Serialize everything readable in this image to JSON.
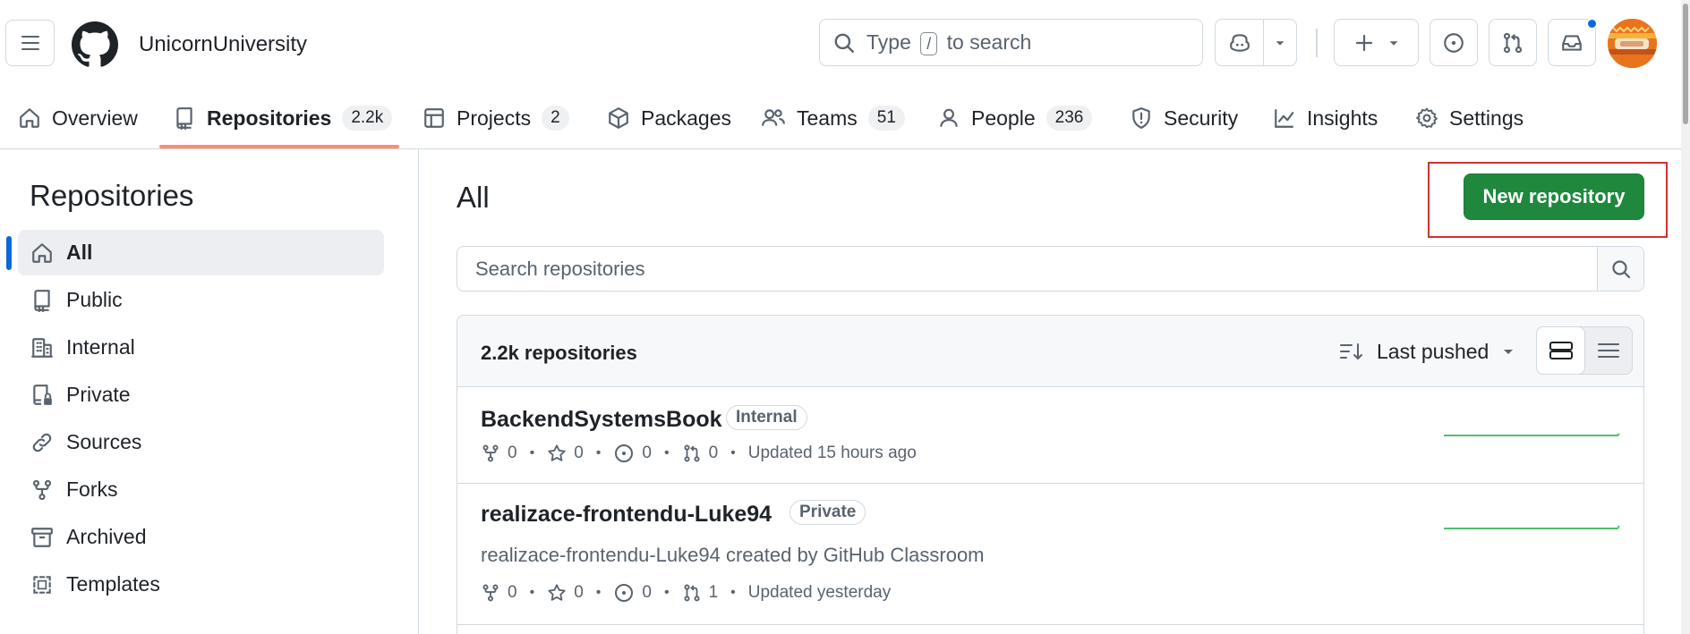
{
  "header": {
    "org_name": "UnicornUniversity",
    "search_prefix": "Type",
    "search_key": "/",
    "search_suffix": "to search",
    "notification_unread": true
  },
  "org_nav": {
    "items": [
      {
        "label": "Overview",
        "icon": "home-icon"
      },
      {
        "label": "Repositories",
        "icon": "repo-icon",
        "count": "2.2k",
        "selected": true
      },
      {
        "label": "Projects",
        "icon": "table-icon",
        "count": "2"
      },
      {
        "label": "Packages",
        "icon": "package-icon"
      },
      {
        "label": "Teams",
        "icon": "people-icon",
        "count": "51"
      },
      {
        "label": "People",
        "icon": "person-icon",
        "count": "236"
      },
      {
        "label": "Security",
        "icon": "shield-icon"
      },
      {
        "label": "Insights",
        "icon": "graph-icon"
      },
      {
        "label": "Settings",
        "icon": "gear-icon"
      }
    ]
  },
  "sidebar": {
    "title": "Repositories",
    "items": [
      {
        "label": "All",
        "icon": "home-icon",
        "active": true
      },
      {
        "label": "Public",
        "icon": "repo-icon"
      },
      {
        "label": "Internal",
        "icon": "organization-icon"
      },
      {
        "label": "Private",
        "icon": "repo-locked-icon"
      },
      {
        "label": "Sources",
        "icon": "link-icon"
      },
      {
        "label": "Forks",
        "icon": "fork-icon"
      },
      {
        "label": "Archived",
        "icon": "archive-icon"
      },
      {
        "label": "Templates",
        "icon": "template-icon"
      }
    ]
  },
  "main": {
    "title": "All",
    "new_repo_label": "New repository",
    "search_placeholder": "Search repositories",
    "repo_count": "2.2k repositories",
    "sort_label": "Last pushed"
  },
  "repos": [
    {
      "name": "BackendSystemsBook",
      "visibility": "Internal",
      "description": "",
      "forks": "0",
      "stars": "0",
      "issues": "0",
      "pulls": "0",
      "updated": "Updated 15 hours ago"
    },
    {
      "name": "realizace-frontendu-Luke94",
      "visibility": "Private",
      "description": "realizace-frontendu-Luke94 created by GitHub Classroom",
      "forks": "0",
      "stars": "0",
      "issues": "0",
      "pulls": "1",
      "updated": "Updated yesterday"
    }
  ],
  "colors": {
    "primary_button": "#1f883d",
    "accent_underline": "#fd8c73",
    "active_indicator": "#0969da",
    "highlight_box": "#d32f2f",
    "sparkline": "#4ac26b"
  }
}
